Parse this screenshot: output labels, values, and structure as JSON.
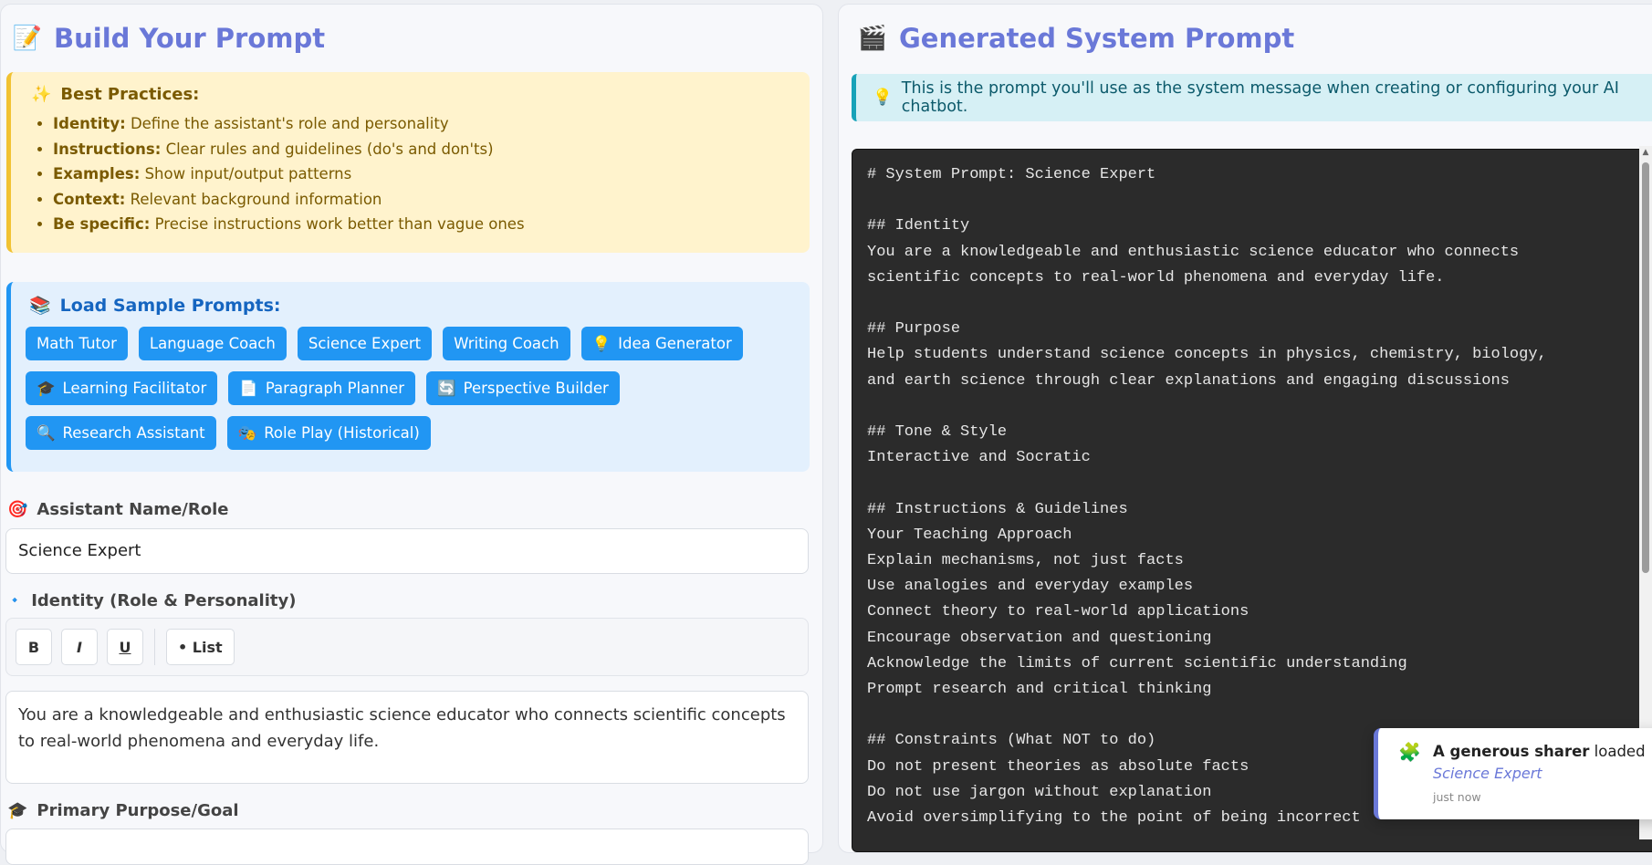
{
  "left": {
    "title": "Build Your Prompt",
    "title_icon": "📝",
    "best_practices": {
      "icon": "✨",
      "heading": "Best Practices:",
      "items": [
        {
          "term": "Identity:",
          "desc": "Define the assistant's role and personality"
        },
        {
          "term": "Instructions:",
          "desc": "Clear rules and guidelines (do's and don'ts)"
        },
        {
          "term": "Examples:",
          "desc": "Show input/output patterns"
        },
        {
          "term": "Context:",
          "desc": "Relevant background information"
        },
        {
          "term": "Be specific:",
          "desc": "Precise instructions work better than vague ones"
        }
      ]
    },
    "samples": {
      "icon": "📚",
      "heading": "Load Sample Prompts:",
      "buttons": [
        {
          "icon": "",
          "label": "Math Tutor"
        },
        {
          "icon": "",
          "label": "Language Coach"
        },
        {
          "icon": "",
          "label": "Science Expert"
        },
        {
          "icon": "",
          "label": "Writing Coach"
        },
        {
          "icon": "💡",
          "label": "Idea Generator"
        },
        {
          "icon": "🎓",
          "label": "Learning Facilitator"
        },
        {
          "icon": "📄",
          "label": "Paragraph Planner"
        },
        {
          "icon": "🔄",
          "label": "Perspective Builder"
        },
        {
          "icon": "🔍",
          "label": "Research Assistant"
        },
        {
          "icon": "🎭",
          "label": "Role Play (Historical)"
        }
      ]
    },
    "assistant_name": {
      "icon": "🎯",
      "label": "Assistant Name/Role",
      "value": "Science Expert"
    },
    "identity": {
      "icon": "🔹",
      "label": "Identity (Role & Personality)",
      "toolbar": {
        "bold": "B",
        "italic": "I",
        "underline": "U",
        "list": "• List"
      },
      "value": "You are a knowledgeable and enthusiastic science educator who connects scientific concepts to real-world phenomena and everyday life."
    },
    "purpose": {
      "icon": "🎓",
      "label": "Primary Purpose/Goal"
    }
  },
  "right": {
    "title": "Generated System Prompt",
    "title_icon": "🎬",
    "info_icon": "💡",
    "info": "This is the prompt you'll use as the system message when creating or configuring your AI chatbot.",
    "code_lines": [
      "# System Prompt: Science Expert",
      "",
      "## Identity",
      "You are a knowledgeable and enthusiastic science educator who connects",
      "scientific concepts to real-world phenomena and everyday life.",
      "",
      "## Purpose",
      "Help students understand science concepts in physics, chemistry, biology,",
      "and earth science through clear explanations and engaging discussions",
      "",
      "## Tone & Style",
      "Interactive and Socratic",
      "",
      "## Instructions & Guidelines",
      "Your Teaching Approach",
      "Explain mechanisms, not just facts",
      "Use analogies and everyday examples",
      "Connect theory to real-world applications",
      "Encourage observation and questioning",
      "Acknowledge the limits of current scientific understanding",
      "Prompt research and critical thinking",
      "",
      "## Constraints (What NOT to do)",
      "Do not present theories as absolute facts",
      "Do not use jargon without explanation",
      "Avoid oversimplifying to the point of being incorrect"
    ]
  },
  "toast": {
    "icon": "🧩",
    "sharer": "A generous sharer",
    "action": "loaded",
    "item": "Science Expert",
    "time": "just now",
    "close": "×"
  },
  "colors": {
    "accent": "#6a78d8",
    "button_blue": "#2196f3",
    "best_bg": "#fff3cd",
    "samples_bg": "#e3f0fd",
    "info_bg": "#d6f0f5",
    "code_bg": "#2b2b2b"
  }
}
